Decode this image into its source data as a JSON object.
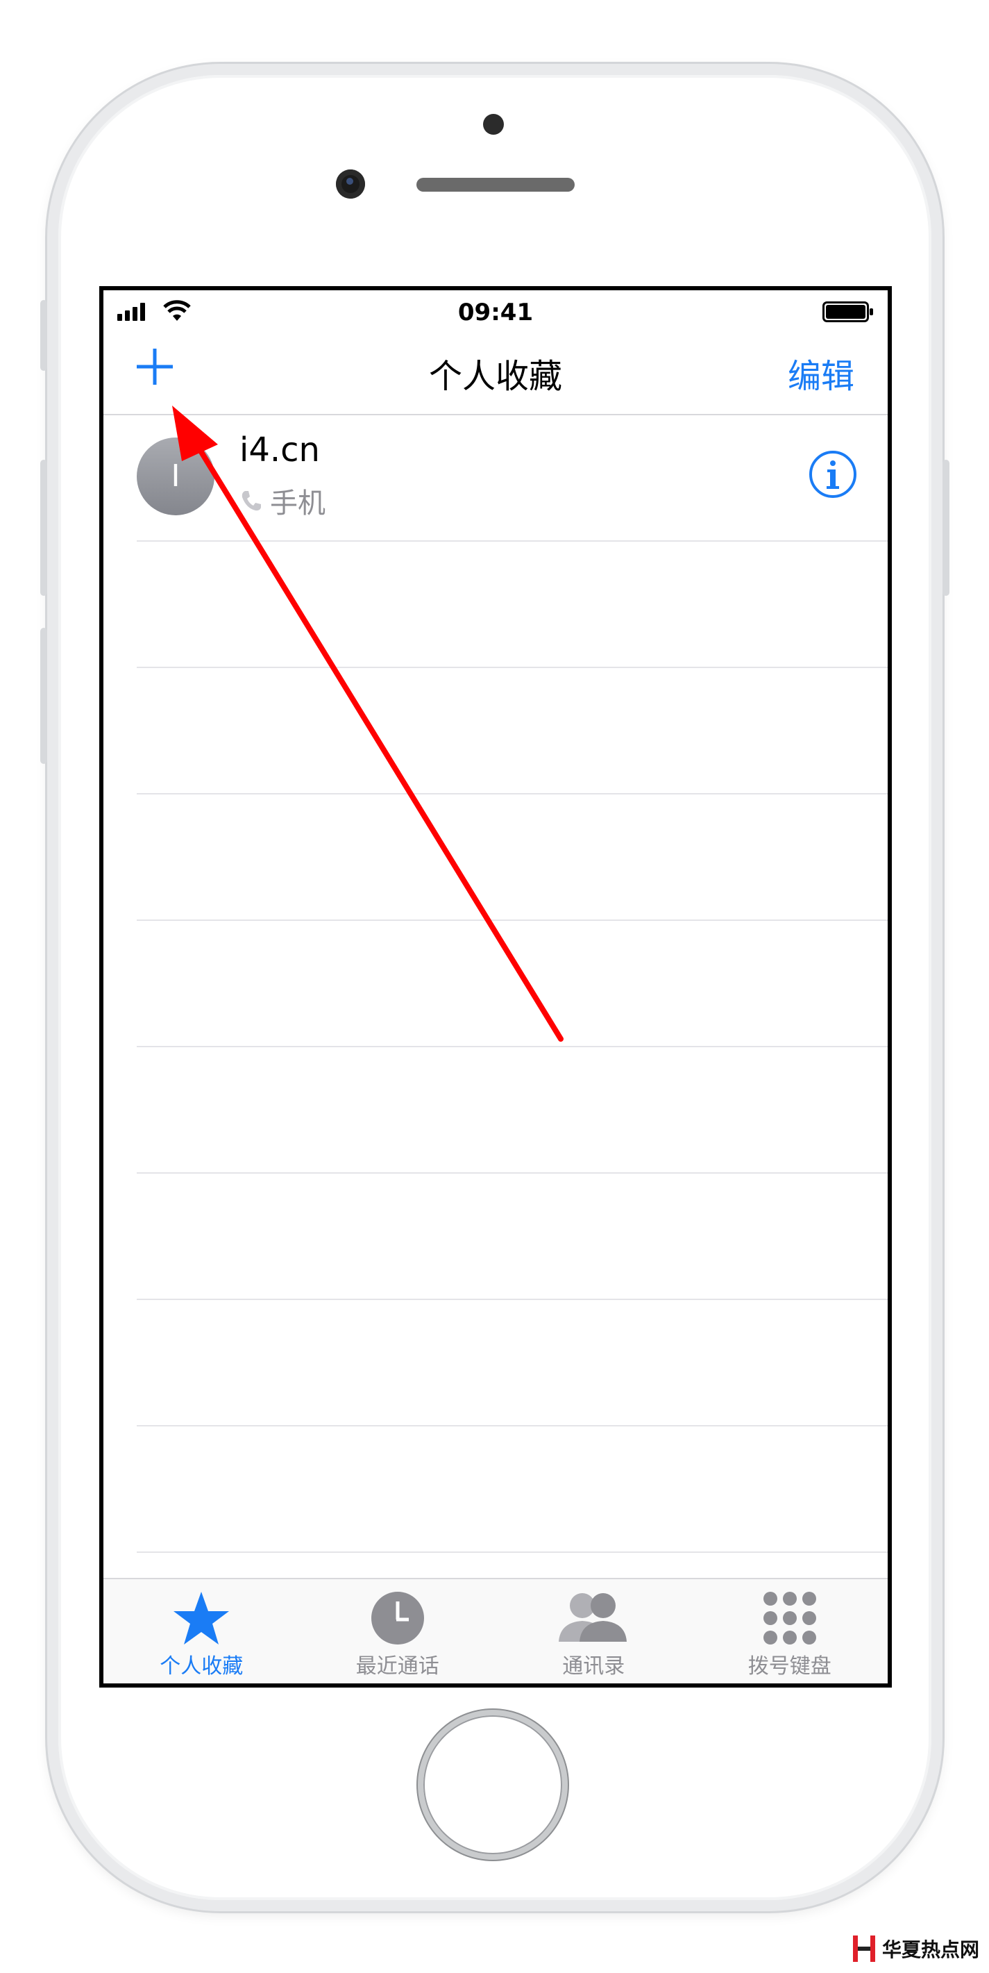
{
  "status_bar": {
    "time": "09:41"
  },
  "nav": {
    "title": "个人收藏",
    "edit_label": "编辑"
  },
  "favorites": [
    {
      "initial": "I",
      "name": "i4.cn",
      "label": "手机"
    }
  ],
  "tabs": [
    {
      "label": "个人收藏",
      "icon": "star-icon",
      "active": true
    },
    {
      "label": "最近通话",
      "icon": "clock-icon",
      "active": false
    },
    {
      "label": "通讯录",
      "icon": "contacts-icon",
      "active": false
    },
    {
      "label": "拨号键盘",
      "icon": "keypad-icon",
      "active": false
    }
  ],
  "colors": {
    "accent": "#1a7cf5",
    "arrow": "#ff0000"
  },
  "watermark": {
    "text": "华夏热点网"
  }
}
